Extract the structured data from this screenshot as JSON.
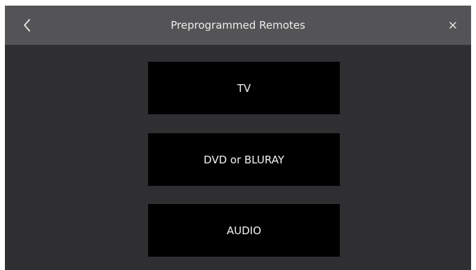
{
  "header": {
    "title": "Preprogrammed Remotes",
    "back_icon": "chevron-left-icon",
    "close_icon": "close-icon"
  },
  "options": [
    {
      "label": "TV"
    },
    {
      "label": "DVD or BLURAY"
    },
    {
      "label": "AUDIO"
    }
  ],
  "colors": {
    "header_bg": "#545456",
    "body_bg": "#2f2e31",
    "button_bg": "#000000",
    "text": "#f2f2f2"
  }
}
